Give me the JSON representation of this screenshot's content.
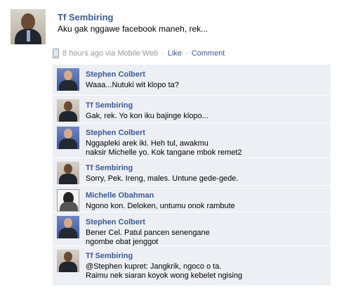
{
  "post": {
    "author": "Tf Sembiring",
    "text": "Aku gak nggawe facebook maneh, rek...",
    "time": "8 hours ago via Mobile Web",
    "separator": "·",
    "like_label": "Like",
    "comment_label": "Comment"
  },
  "comments": [
    {
      "author": "Stephen Colbert",
      "lines": [
        "Waaa...Nutuki wit klopo ta?"
      ]
    },
    {
      "author": "Tf Sembiring",
      "lines": [
        "Gak, rek. Yo kon iku bajinge klopo..."
      ]
    },
    {
      "author": "Stephen Colbert",
      "lines": [
        "Nggapleki arek iki. Heh tul, awakmu",
        "naksir Michelle yo. Kok tangane mbok remet2"
      ]
    },
    {
      "author": "Tf Sembiring",
      "lines": [
        "Sorry, Pek. Ireng, males. Untune gede-gede."
      ]
    },
    {
      "author": "Michelle Obahman",
      "lines": [
        "Ngono kon. Deloken, untumu onok rambute"
      ]
    },
    {
      "author": "Stephen Colbert",
      "lines": [
        "Bener Cel. Patul pancen senengane",
        "ngombe obat jenggot"
      ]
    },
    {
      "author": "Tf Sembiring",
      "lines": [
        "@Stephen kupret: Jangkrik, ngoco o ta.",
        "Raimu nek siaran koyok wong kebelet ngising"
      ]
    }
  ],
  "colors": {
    "link": "#3b5998",
    "comment_bg": "#edeff4",
    "meta_text": "#999999"
  },
  "icons": [
    "mobile-phone-icon"
  ]
}
